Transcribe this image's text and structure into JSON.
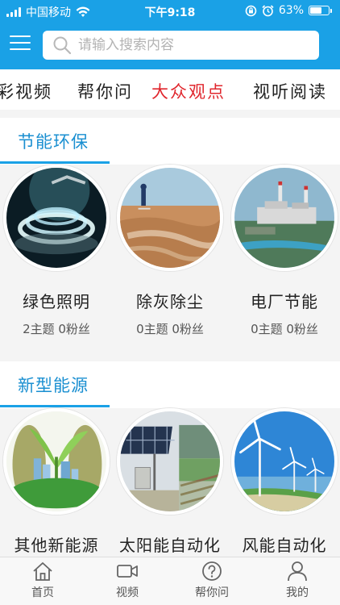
{
  "status_bar": {
    "carrier": "中国移动",
    "time": "下午9:18",
    "battery_percent": "63%",
    "battery_level": 0.63,
    "icons": [
      "signal-icon",
      "wifi-icon",
      "rotation-lock-icon",
      "alarm-icon",
      "battery-icon"
    ]
  },
  "header": {
    "menu_icon": "hamburger-menu-icon",
    "search_placeholder": "请输入搜索内容",
    "search_icon": "search-icon"
  },
  "tabs": [
    {
      "label": "彩视频",
      "active": false
    },
    {
      "label": "帮你问",
      "active": false
    },
    {
      "label": "大众观点",
      "active": true
    },
    {
      "label": "视听阅读",
      "active": false
    }
  ],
  "sections": [
    {
      "title": "节能环保",
      "items": [
        {
          "title": "绿色照明",
          "stats": "2主题 0粉丝",
          "image": "led-strip-image"
        },
        {
          "title": "除灰除尘",
          "stats": "0主题 0粉丝",
          "image": "dust-plain-image"
        },
        {
          "title": "电厂节能",
          "stats": "0主题 0粉丝",
          "image": "power-plant-image"
        }
      ]
    },
    {
      "title": "新型能源",
      "items": [
        {
          "title": "其他新能源",
          "image": "green-city-sprout-image"
        },
        {
          "title": "太阳能自动化",
          "image": "solar-panel-image"
        },
        {
          "title": "风能自动化",
          "image": "wind-turbine-image"
        }
      ]
    }
  ],
  "bottom_nav": [
    {
      "label": "首页",
      "icon": "home-icon"
    },
    {
      "label": "视频",
      "icon": "video-camera-icon"
    },
    {
      "label": "帮你问",
      "icon": "question-icon"
    },
    {
      "label": "我的",
      "icon": "user-icon"
    }
  ],
  "colors": {
    "primary": "#1aa1e6",
    "active_tab": "#e0262d",
    "section_title": "#1a8fd1"
  }
}
